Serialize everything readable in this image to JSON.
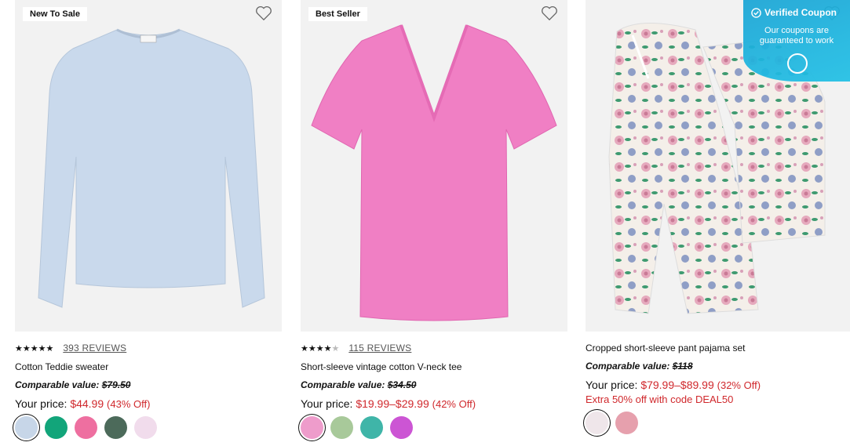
{
  "products": [
    {
      "badge": "New To Sale",
      "stars": "★★★★★",
      "reviews": "393 REVIEWS",
      "name": "Cotton Teddie sweater",
      "comparable_label": "Comparable value:",
      "comparable_price": "$79.50",
      "price_label": "Your price:",
      "sale_price": "$44.99",
      "discount": "(43% Off)",
      "swatch_colors": [
        "#c7d6e8",
        "#12a57a",
        "#ee6fa0",
        "#4c6a5a",
        "#f1dcec"
      ]
    },
    {
      "badge": "Best Seller",
      "stars": "★★★★",
      "half_star": "★",
      "reviews": "115 REVIEWS",
      "name": "Short-sleeve vintage cotton V-neck tee",
      "comparable_label": "Comparable value:",
      "comparable_price": "$34.50",
      "price_label": "Your price:",
      "sale_price": "$19.99–$29.99",
      "discount": "(42% Off)",
      "swatch_colors": [
        "#ee9ccb",
        "#a8c99a",
        "#3fb5a8",
        "#cc55d4"
      ]
    },
    {
      "name": "Cropped short-sleeve pant pajama set",
      "comparable_label": "Comparable value:",
      "comparable_price": "$118",
      "price_label": "Your price:",
      "sale_price": "$79.99–$89.99",
      "discount": "(32% Off)",
      "extra_offer": "Extra 50% off with code DEAL50",
      "swatch_colors": [
        "#efe6ea",
        "#e6a0ad"
      ]
    }
  ],
  "coupon": {
    "title": "Verified Coupon",
    "subtitle": "Our coupons are guaranteed to work"
  },
  "colors": {
    "sale_red": "#d0282c",
    "coupon_blue": "#1aa5d6",
    "sweater": "#c9d9ec",
    "tee": "#f07fc4"
  }
}
